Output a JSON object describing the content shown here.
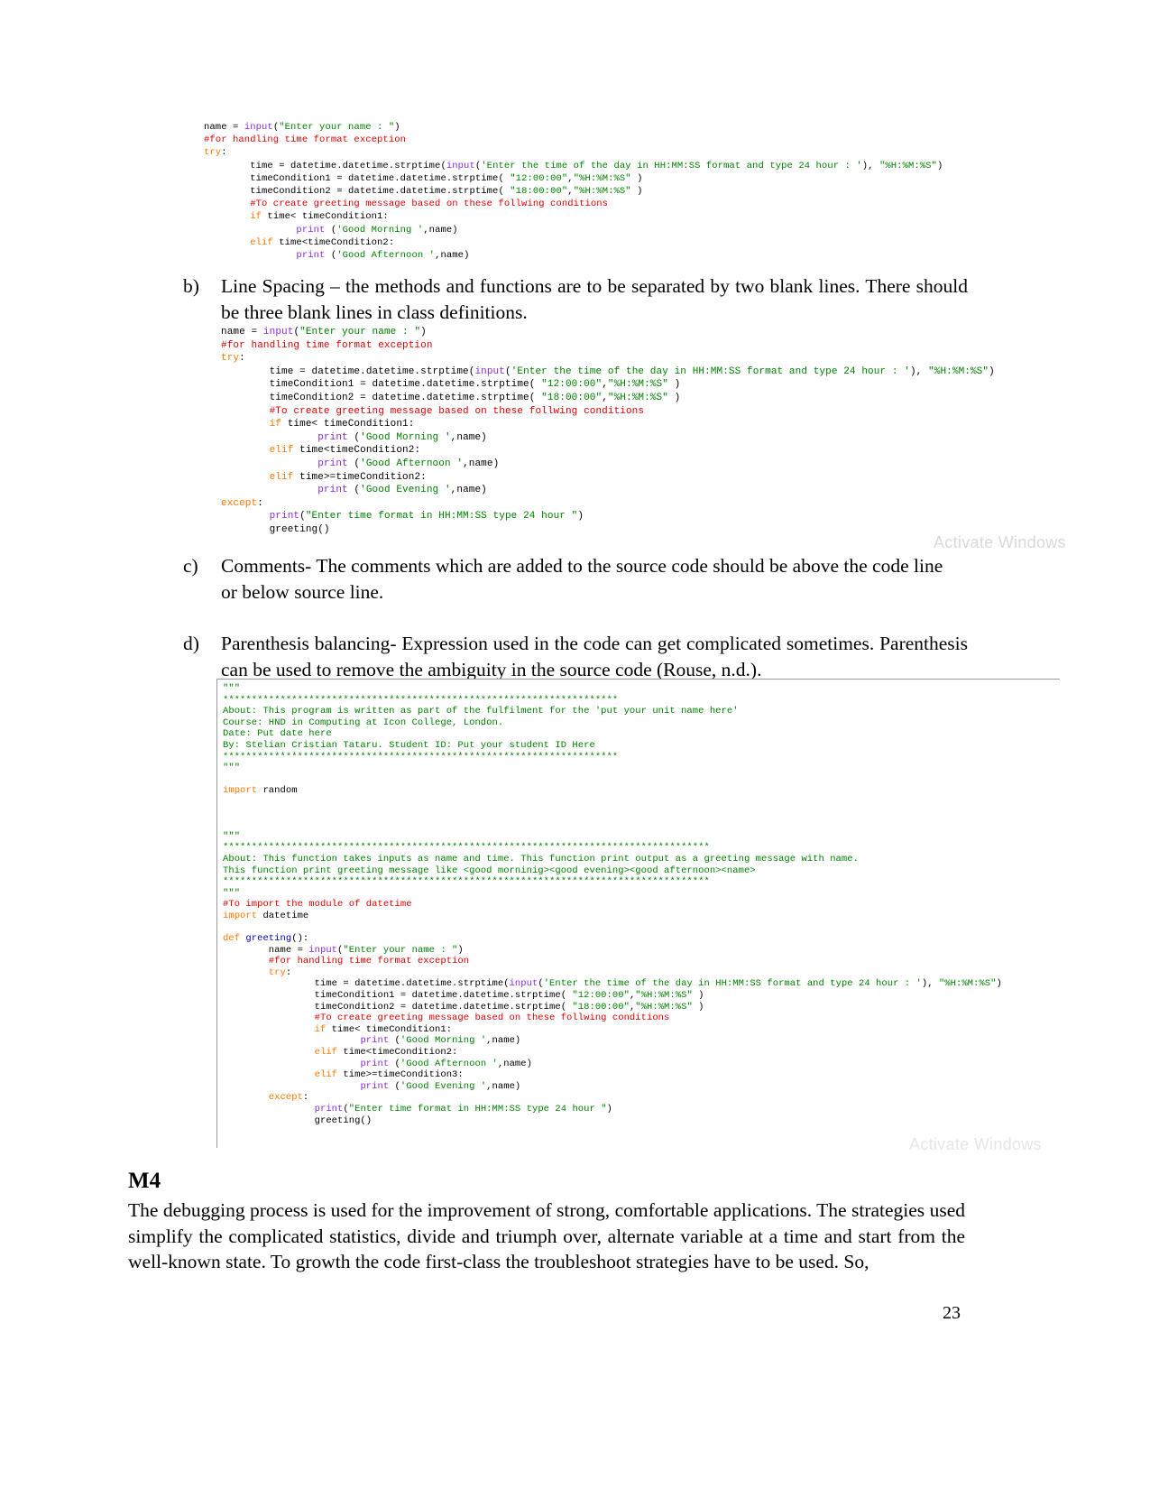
{
  "page": {
    "number": "23"
  },
  "watermarks": {
    "first": "Activate Windows",
    "second": "Activate Windows"
  },
  "items": [
    {
      "marker": "b)",
      "text": "Line Spacing – the methods and functions are to be separated by two blank lines. There should be three blank lines in class definitions."
    },
    {
      "marker": "c)",
      "text": "Comments- The comments which are added to the source code should be above the code line or below source line."
    },
    {
      "marker": "d)",
      "text": "Parenthesis balancing- Expression used in the code can get complicated sometimes. Parenthesis can be used to remove the ambiguity in the source code (Rouse, n.d.)."
    }
  ],
  "code_block_1": {
    "lines": [
      [
        {
          "t": "name = ",
          "c": "k-txt"
        },
        {
          "t": "input",
          "c": "k-fn"
        },
        {
          "t": "(",
          "c": "k-txt"
        },
        {
          "t": "\"Enter your name : \"",
          "c": "k-str"
        },
        {
          "t": ")",
          "c": "k-txt"
        }
      ],
      [
        {
          "t": "#for handling time format exception",
          "c": "k-cmt"
        }
      ],
      [
        {
          "t": "try",
          "c": "k-kw"
        },
        {
          "t": ":",
          "c": "k-txt"
        }
      ],
      [
        {
          "t": "        time = datetime.datetime.strptime(",
          "c": "k-txt"
        },
        {
          "t": "input",
          "c": "k-fn"
        },
        {
          "t": "(",
          "c": "k-txt"
        },
        {
          "t": "'Enter the time of the day in HH:MM:SS format and type 24 hour : '",
          "c": "k-str"
        },
        {
          "t": "), ",
          "c": "k-txt"
        },
        {
          "t": "\"%H:%M:%S\"",
          "c": "k-str"
        },
        {
          "t": ")",
          "c": "k-txt"
        }
      ],
      [
        {
          "t": "        timeCondition1 = datetime.datetime.strptime( ",
          "c": "k-txt"
        },
        {
          "t": "\"12:00:00\"",
          "c": "k-str"
        },
        {
          "t": ",",
          "c": "k-txt"
        },
        {
          "t": "\"%H:%M:%S\"",
          "c": "k-str"
        },
        {
          "t": " )",
          "c": "k-txt"
        }
      ],
      [
        {
          "t": "        timeCondition2 = datetime.datetime.strptime( ",
          "c": "k-txt"
        },
        {
          "t": "\"18:00:00\"",
          "c": "k-str"
        },
        {
          "t": ",",
          "c": "k-txt"
        },
        {
          "t": "\"%H:%M:%S\"",
          "c": "k-str"
        },
        {
          "t": " )",
          "c": "k-txt"
        }
      ],
      [
        {
          "t": "        #To create greeting message based on these follwing conditions",
          "c": "k-cmt"
        }
      ],
      [
        {
          "t": "        if",
          "c": "k-kw"
        },
        {
          "t": " time< timeCondition1:",
          "c": "k-txt"
        }
      ],
      [
        {
          "t": "                ",
          "c": "k-txt"
        },
        {
          "t": "print",
          "c": "k-fn"
        },
        {
          "t": " (",
          "c": "k-txt"
        },
        {
          "t": "'Good Morning '",
          "c": "k-str"
        },
        {
          "t": ",name)",
          "c": "k-txt"
        }
      ],
      [
        {
          "t": "        elif",
          "c": "k-kw"
        },
        {
          "t": " time<timeCondition2:",
          "c": "k-txt"
        }
      ],
      [
        {
          "t": "                ",
          "c": "k-txt"
        },
        {
          "t": "print",
          "c": "k-fn"
        },
        {
          "t": " (",
          "c": "k-txt"
        },
        {
          "t": "'Good Afternoon '",
          "c": "k-str"
        },
        {
          "t": ",name)",
          "c": "k-txt"
        }
      ]
    ]
  },
  "code_block_2": {
    "lines": [
      [
        {
          "t": "name = ",
          "c": "k-txt"
        },
        {
          "t": "input",
          "c": "k-fn"
        },
        {
          "t": "(",
          "c": "k-txt"
        },
        {
          "t": "\"Enter your name : \"",
          "c": "k-str"
        },
        {
          "t": ")",
          "c": "k-txt"
        }
      ],
      [
        {
          "t": "#for handling time format exception",
          "c": "k-cmt"
        }
      ],
      [
        {
          "t": "try",
          "c": "k-kw"
        },
        {
          "t": ":",
          "c": "k-txt"
        }
      ],
      [
        {
          "t": "        time = datetime.datetime.strptime(",
          "c": "k-txt"
        },
        {
          "t": "input",
          "c": "k-fn"
        },
        {
          "t": "(",
          "c": "k-txt"
        },
        {
          "t": "'Enter the time of the day in HH:MM:SS format and type 24 hour : '",
          "c": "k-str"
        },
        {
          "t": "), ",
          "c": "k-txt"
        },
        {
          "t": "\"%H:%M:%S\"",
          "c": "k-str"
        },
        {
          "t": ")",
          "c": "k-txt"
        }
      ],
      [
        {
          "t": "        timeCondition1 = datetime.datetime.strptime( ",
          "c": "k-txt"
        },
        {
          "t": "\"12:00:00\"",
          "c": "k-str"
        },
        {
          "t": ",",
          "c": "k-txt"
        },
        {
          "t": "\"%H:%M:%S\"",
          "c": "k-str"
        },
        {
          "t": " )",
          "c": "k-txt"
        }
      ],
      [
        {
          "t": "        timeCondition2 = datetime.datetime.strptime( ",
          "c": "k-txt"
        },
        {
          "t": "\"18:00:00\"",
          "c": "k-str"
        },
        {
          "t": ",",
          "c": "k-txt"
        },
        {
          "t": "\"%H:%M:%S\"",
          "c": "k-str"
        },
        {
          "t": " )",
          "c": "k-txt"
        }
      ],
      [
        {
          "t": "        #To create greeting message based on these follwing conditions",
          "c": "k-cmt"
        }
      ],
      [
        {
          "t": "        if",
          "c": "k-kw"
        },
        {
          "t": " time< timeCondition1:",
          "c": "k-txt"
        }
      ],
      [
        {
          "t": "                ",
          "c": "k-txt"
        },
        {
          "t": "print",
          "c": "k-fn"
        },
        {
          "t": " (",
          "c": "k-txt"
        },
        {
          "t": "'Good Morning '",
          "c": "k-str"
        },
        {
          "t": ",name)",
          "c": "k-txt"
        }
      ],
      [
        {
          "t": "        elif",
          "c": "k-kw"
        },
        {
          "t": " time<timeCondition2:",
          "c": "k-txt"
        }
      ],
      [
        {
          "t": "                ",
          "c": "k-txt"
        },
        {
          "t": "print",
          "c": "k-fn"
        },
        {
          "t": " (",
          "c": "k-txt"
        },
        {
          "t": "'Good Afternoon '",
          "c": "k-str"
        },
        {
          "t": ",name)",
          "c": "k-txt"
        }
      ],
      [
        {
          "t": "        elif",
          "c": "k-kw"
        },
        {
          "t": " time>=timeCondition2:",
          "c": "k-txt"
        }
      ],
      [
        {
          "t": "                ",
          "c": "k-txt"
        },
        {
          "t": "print",
          "c": "k-fn"
        },
        {
          "t": " (",
          "c": "k-txt"
        },
        {
          "t": "'Good Evening '",
          "c": "k-str"
        },
        {
          "t": ",name)",
          "c": "k-txt"
        }
      ],
      [
        {
          "t": "except",
          "c": "k-kw"
        },
        {
          "t": ":",
          "c": "k-txt"
        }
      ],
      [
        {
          "t": "        ",
          "c": "k-txt"
        },
        {
          "t": "print",
          "c": "k-fn"
        },
        {
          "t": "(",
          "c": "k-txt"
        },
        {
          "t": "\"Enter time format in HH:MM:SS type 24 hour \"",
          "c": "k-str"
        },
        {
          "t": ")",
          "c": "k-txt"
        }
      ],
      [
        {
          "t": "        greeting()",
          "c": "k-txt"
        }
      ]
    ]
  },
  "code_block_3": {
    "lines": [
      [
        {
          "t": "\"\"\"",
          "c": "k-str"
        }
      ],
      [
        {
          "t": "*********************************************************************",
          "c": "k-str"
        }
      ],
      [
        {
          "t": "About: This program is written as part of the fulfilment for the 'put your unit name here'",
          "c": "k-str"
        }
      ],
      [
        {
          "t": "Course: HND in Computing at Icon College, London.",
          "c": "k-str"
        }
      ],
      [
        {
          "t": "Date: Put date here",
          "c": "k-str"
        }
      ],
      [
        {
          "t": "By: Stelian Cristian Tataru. Student ID: Put your student ID Here",
          "c": "k-str"
        }
      ],
      [
        {
          "t": "*********************************************************************",
          "c": "k-str"
        }
      ],
      [
        {
          "t": "\"\"\"",
          "c": "k-str"
        }
      ],
      [
        {
          "t": "",
          "c": "k-txt"
        }
      ],
      [
        {
          "t": "import",
          "c": "k-kw"
        },
        {
          "t": " random",
          "c": "k-txt"
        }
      ],
      [
        {
          "t": "",
          "c": "k-txt"
        }
      ],
      [
        {
          "t": "",
          "c": "k-txt"
        }
      ],
      [
        {
          "t": "",
          "c": "k-txt"
        }
      ],
      [
        {
          "t": "\"\"\"",
          "c": "k-str"
        }
      ],
      [
        {
          "t": "*************************************************************************************",
          "c": "k-str"
        }
      ],
      [
        {
          "t": "About: This function takes inputs as name and time. This function print output as a greeting message with name.",
          "c": "k-str"
        }
      ],
      [
        {
          "t": "This function print greeting message like <good morninig><good evening><good afternoon><name>",
          "c": "k-str"
        }
      ],
      [
        {
          "t": "*************************************************************************************",
          "c": "k-str"
        }
      ],
      [
        {
          "t": "\"\"\"",
          "c": "k-str"
        }
      ],
      [
        {
          "t": "#To import the module of datetime",
          "c": "k-cmt"
        }
      ],
      [
        {
          "t": "import",
          "c": "k-kw"
        },
        {
          "t": " datetime",
          "c": "k-txt"
        }
      ],
      [
        {
          "t": "",
          "c": "k-txt"
        }
      ],
      [
        {
          "t": "def ",
          "c": "k-kw"
        },
        {
          "t": "greeting",
          "c": "k-def"
        },
        {
          "t": "():",
          "c": "k-txt"
        }
      ],
      [
        {
          "t": "        name = ",
          "c": "k-txt"
        },
        {
          "t": "input",
          "c": "k-fn"
        },
        {
          "t": "(",
          "c": "k-txt"
        },
        {
          "t": "\"Enter your name : \"",
          "c": "k-str"
        },
        {
          "t": ")",
          "c": "k-txt"
        }
      ],
      [
        {
          "t": "        #for handling time format exception",
          "c": "k-cmt"
        }
      ],
      [
        {
          "t": "        try",
          "c": "k-kw"
        },
        {
          "t": ":",
          "c": "k-txt"
        }
      ],
      [
        {
          "t": "                time = datetime.datetime.strptime(",
          "c": "k-txt"
        },
        {
          "t": "input",
          "c": "k-fn"
        },
        {
          "t": "(",
          "c": "k-txt"
        },
        {
          "t": "'Enter the time of the day in HH:MM:SS format and type 24 hour : '",
          "c": "k-str"
        },
        {
          "t": "), ",
          "c": "k-txt"
        },
        {
          "t": "\"%H:%M:%S\"",
          "c": "k-str"
        },
        {
          "t": ")",
          "c": "k-txt"
        }
      ],
      [
        {
          "t": "                timeCondition1 = datetime.datetime.strptime( ",
          "c": "k-txt"
        },
        {
          "t": "\"12:00:00\"",
          "c": "k-str"
        },
        {
          "t": ",",
          "c": "k-txt"
        },
        {
          "t": "\"%H:%M:%S\"",
          "c": "k-str"
        },
        {
          "t": " )",
          "c": "k-txt"
        }
      ],
      [
        {
          "t": "                timeCondition2 = datetime.datetime.strptime( ",
          "c": "k-txt"
        },
        {
          "t": "\"18:00:00\"",
          "c": "k-str"
        },
        {
          "t": ",",
          "c": "k-txt"
        },
        {
          "t": "\"%H:%M:%S\"",
          "c": "k-str"
        },
        {
          "t": " )",
          "c": "k-txt"
        }
      ],
      [
        {
          "t": "                #To create greeting message based on these follwing conditions",
          "c": "k-cmt"
        }
      ],
      [
        {
          "t": "                if",
          "c": "k-kw"
        },
        {
          "t": " time< timeCondition1:",
          "c": "k-txt"
        }
      ],
      [
        {
          "t": "                        ",
          "c": "k-txt"
        },
        {
          "t": "print",
          "c": "k-fn"
        },
        {
          "t": " (",
          "c": "k-txt"
        },
        {
          "t": "'Good Morning '",
          "c": "k-str"
        },
        {
          "t": ",name)",
          "c": "k-txt"
        }
      ],
      [
        {
          "t": "                elif",
          "c": "k-kw"
        },
        {
          "t": " time<timeCondition2:",
          "c": "k-txt"
        }
      ],
      [
        {
          "t": "                        ",
          "c": "k-txt"
        },
        {
          "t": "print",
          "c": "k-fn"
        },
        {
          "t": " (",
          "c": "k-txt"
        },
        {
          "t": "'Good Afternoon '",
          "c": "k-str"
        },
        {
          "t": ",name)",
          "c": "k-txt"
        }
      ],
      [
        {
          "t": "                elif",
          "c": "k-kw"
        },
        {
          "t": " time>=timeCondition3:",
          "c": "k-txt"
        }
      ],
      [
        {
          "t": "                        ",
          "c": "k-txt"
        },
        {
          "t": "print",
          "c": "k-fn"
        },
        {
          "t": " (",
          "c": "k-txt"
        },
        {
          "t": "'Good Evening '",
          "c": "k-str"
        },
        {
          "t": ",name)",
          "c": "k-txt"
        }
      ],
      [
        {
          "t": "        except",
          "c": "k-kw"
        },
        {
          "t": ":",
          "c": "k-txt"
        }
      ],
      [
        {
          "t": "                ",
          "c": "k-txt"
        },
        {
          "t": "print",
          "c": "k-fn"
        },
        {
          "t": "(",
          "c": "k-txt"
        },
        {
          "t": "\"Enter time format in HH:MM:SS type 24 hour \"",
          "c": "k-str"
        },
        {
          "t": ")",
          "c": "k-txt"
        }
      ],
      [
        {
          "t": "                greeting()",
          "c": "k-txt"
        }
      ]
    ]
  },
  "m4": {
    "heading": "M4",
    "paragraph": "The debugging process is used for the improvement of strong, comfortable applications. The strategies used simplify the complicated statistics, divide and triumph over, alternate variable at a time and start from the well-known state. To growth the code first-class the troubleshoot strategies have to be used. So,"
  }
}
